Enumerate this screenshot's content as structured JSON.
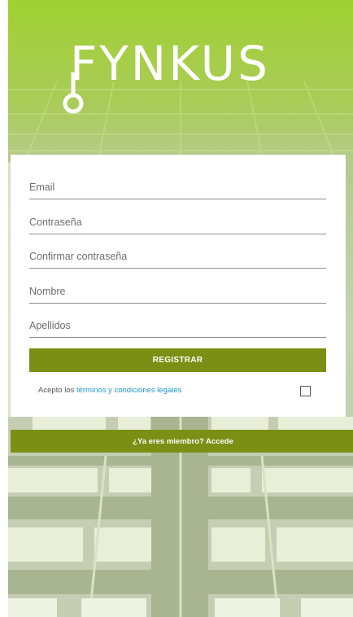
{
  "app": {
    "logo_text": "FYNKUS"
  },
  "form": {
    "email_placeholder": "Email",
    "password_placeholder": "Contraseña",
    "confirm_password_placeholder": "Confirmar contraseña",
    "name_placeholder": "Nombre",
    "surname_placeholder": "Apellidos",
    "register_label": "REGISTRAR",
    "terms_prefix": "Acepto los",
    "terms_link": "términos y condiciones legales",
    "terms_checked": false
  },
  "footer": {
    "login_label": "¿Ya eres miembro? Accede"
  },
  "colors": {
    "brand_green": "#9ccb2b",
    "button_olive": "#7b8f14",
    "link_blue": "#2196d3"
  }
}
